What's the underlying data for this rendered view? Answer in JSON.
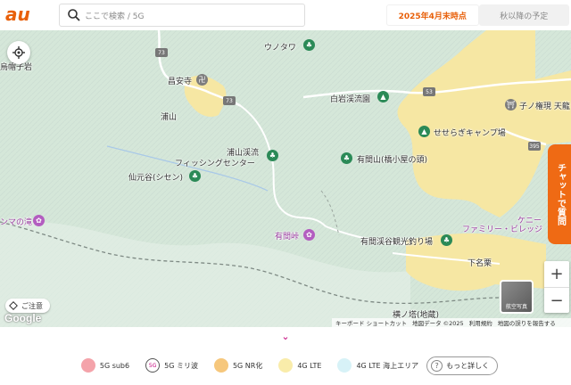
{
  "brand": {
    "logo_text": "au",
    "color": "#e8600a"
  },
  "search": {
    "placeholder": "ここで検索 / 5G"
  },
  "tabs": [
    {
      "label": "2025年4月末時点",
      "active": true
    },
    {
      "label": "秋以降の予定",
      "active": false
    }
  ],
  "map": {
    "labels": {
      "eboshi": "烏帽子岩",
      "unotawa": "ウノタワ",
      "shoanji": "昌安寺",
      "urayama": "浦山",
      "shiraiwa": "白岩渓流園",
      "nenogongen": "子ノ権現 天龍",
      "seseragi": "せせらぎキャンプ場",
      "urayamakeiryu_1": "浦山渓流",
      "urayamakeiryu_2": "フィッシングセンター",
      "arimayama": "有間山(橋小屋の頭)",
      "senmotoya": "仙元谷(シセン)",
      "maotaki": "ンマの滝",
      "arimatoge": "有間峠",
      "arimakei": "有間渓谷観光釣り場",
      "family": "ファミリー・ビレッジ",
      "kenny": "ケニー",
      "shimonago": "下名栗",
      "bottom_cut": "横ノ塔(地蔵)"
    },
    "routes": [
      "73",
      "73",
      "53",
      "395"
    ],
    "notice_label": "ご注意",
    "google_label": "Google",
    "attribution": [
      "キーボード ショートカット",
      "地図データ ©2025",
      "利用規約",
      "地図の誤りを報告する"
    ],
    "aerial_label": "航空写真"
  },
  "chat_label": "チャットで質問",
  "zoom": {
    "in": "+",
    "out": "−"
  },
  "legend": [
    {
      "label": "5G sub6",
      "color": "#f4a3aa"
    },
    {
      "label": "5G ミリ波",
      "color": "#ffffff",
      "badge": "5G"
    },
    {
      "label": "5G NR化",
      "color": "#f6c77c"
    },
    {
      "label": "4G LTE",
      "color": "#f9ecaa"
    },
    {
      "label": "4G LTE 海上エリア",
      "color": "#d7f2f7"
    }
  ],
  "more_label": "もっと詳しく"
}
